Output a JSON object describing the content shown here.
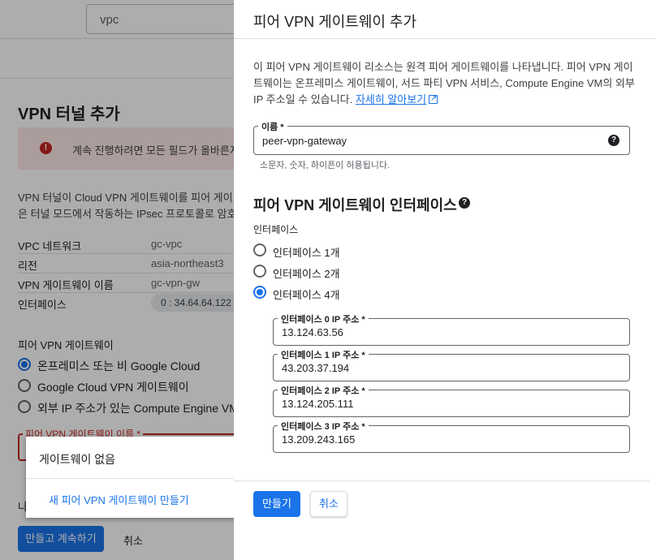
{
  "background": {
    "search_value": "vpc",
    "page_title": "VPN 터널 추가",
    "error_text": "계속 진행하려면 모든 필드가 올바른지 확",
    "error_icon": "error-icon",
    "description_line1": "VPN 터널이 Cloud VPN 게이트웨이를 피어 게이트웨",
    "description_line2": "은 터널 모드에서 작동하는 IPsec 프로토콜로 암호화",
    "details": [
      {
        "key": "VPC 네트워크",
        "value": "gc-vpc"
      },
      {
        "key": "리전",
        "value": "asia-northeast3"
      },
      {
        "key": "VPN 게이트웨이 이름",
        "value": "gc-vpn-gw"
      },
      {
        "key": "인터페이스",
        "value": "0 : 34.64.64.122"
      }
    ],
    "peer_label": "피어 VPN 게이트웨이",
    "peer_options": [
      "온프레미스 또는 비 Google Cloud",
      "Google Cloud VPN 게이트웨이",
      "외부 IP 주소가 있는 Compute Engine VM"
    ],
    "peer_selected": 0,
    "peer_name_label": "피어 VPN 게이트웨이 이름 *",
    "dropdown_none": "게이트웨이 없음",
    "dropdown_create": "새 피어 VPN 게이트웨이 만들기",
    "truncated_text": "나",
    "create_continue": "만들고 계속하기",
    "cancel": "취소"
  },
  "panel": {
    "title": "피어 VPN 게이트웨이 추가",
    "description": "이 피어 VPN 게이트웨이 리소스는 원격 피어 게이트웨이를 나타냅니다. 피어 VPN 게이트웨이는 온프레미스 게이트웨이, 서드 파티 VPN 서비스, Compute Engine VM의 외부 IP 주소일 수 있습니다.",
    "learn_more": "자세히 알아보기",
    "name_label": "이름 *",
    "name_value": "peer-vpn-gateway",
    "name_hint": "소문자, 숫자, 하이픈이 허용됩니다.",
    "help_icon": "help-icon",
    "section_title": "피어 VPN 게이트웨이 인터페이스",
    "interface_label": "인터페이스",
    "interface_options": [
      "인터페이스 1개",
      "인터페이스 2개",
      "인터페이스 4개"
    ],
    "interface_selected": 2,
    "ip_fields": [
      {
        "label": "인터페이스 0 IP 주소 *",
        "value": "13.124.63.56"
      },
      {
        "label": "인터페이스 1 IP 주소 *",
        "value": "43.203.37.194"
      },
      {
        "label": "인터페이스 2 IP 주소 *",
        "value": "13.124.205.111"
      },
      {
        "label": "인터페이스 3 IP 주소 *",
        "value": "13.209.243.165"
      }
    ],
    "create": "만들기",
    "cancel": "취소"
  },
  "colors": {
    "accent": "#1a73e8",
    "error": "#c5221f",
    "error_bg": "#fce8e6"
  }
}
